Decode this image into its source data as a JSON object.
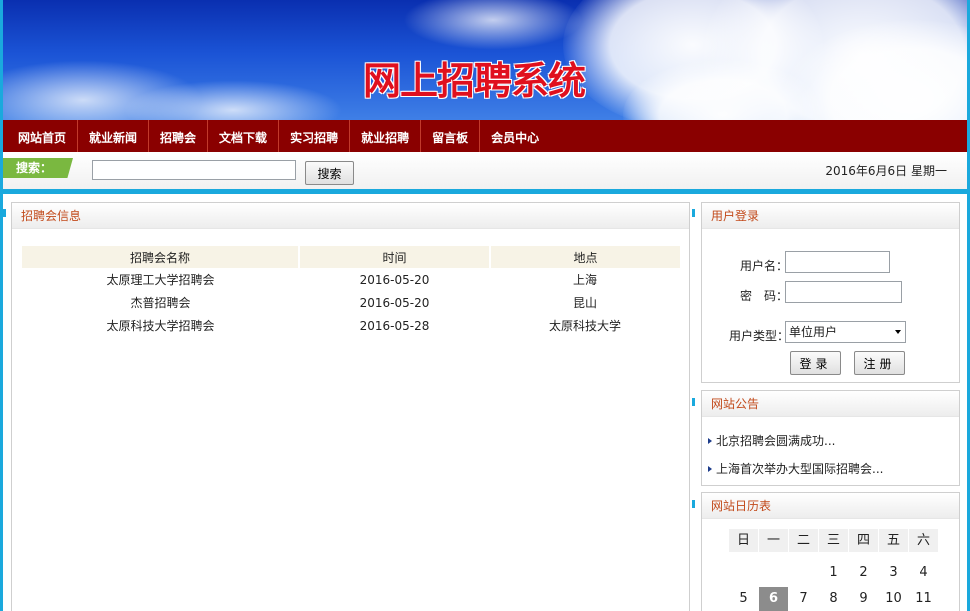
{
  "banner": {
    "title": "网上招聘系统"
  },
  "nav": {
    "items": [
      {
        "label": "网站首页",
        "name": "nav-home"
      },
      {
        "label": "就业新闻",
        "name": "nav-news"
      },
      {
        "label": "招聘会",
        "name": "nav-job-fair"
      },
      {
        "label": "文档下载",
        "name": "nav-downloads"
      },
      {
        "label": "实习招聘",
        "name": "nav-internship"
      },
      {
        "label": "就业招聘",
        "name": "nav-employment"
      },
      {
        "label": "留言板",
        "name": "nav-guestbook"
      },
      {
        "label": "会员中心",
        "name": "nav-member-center"
      }
    ]
  },
  "search": {
    "label": "搜索：",
    "button": "搜索",
    "value": "",
    "placeholder": ""
  },
  "date_text": "2016年6月6日 星期一",
  "fairs": {
    "title": "招聘会信息",
    "headers": [
      "招聘会名称",
      "时间",
      "地点"
    ],
    "rows": [
      [
        "太原理工大学招聘会",
        "2016-05-20",
        "上海"
      ],
      [
        "杰普招聘会",
        "2016-05-20",
        "昆山"
      ],
      [
        "太原科技大学招聘会",
        "2016-05-28",
        "太原科技大学"
      ]
    ]
  },
  "login": {
    "title": "用户登录",
    "username_label": "用户名：",
    "password_label": "密　码：",
    "type_label": "用户类型：",
    "type_selected": "单位用户",
    "login_button": "登录",
    "register_button": "注册"
  },
  "notices": {
    "title": "网站公告",
    "items": [
      "北京招聘会圆满成功...",
      "上海首次举办大型国际招聘会..."
    ]
  },
  "calendar": {
    "title": "网站日历表",
    "weekdays": [
      "日",
      "一",
      "二",
      "三",
      "四",
      "五",
      "六"
    ],
    "row1": [
      "",
      "",
      "",
      "1",
      "2",
      "3",
      "4"
    ],
    "row2": [
      "5",
      "6",
      "7",
      "8",
      "9",
      "10",
      "11"
    ],
    "today": "6"
  }
}
